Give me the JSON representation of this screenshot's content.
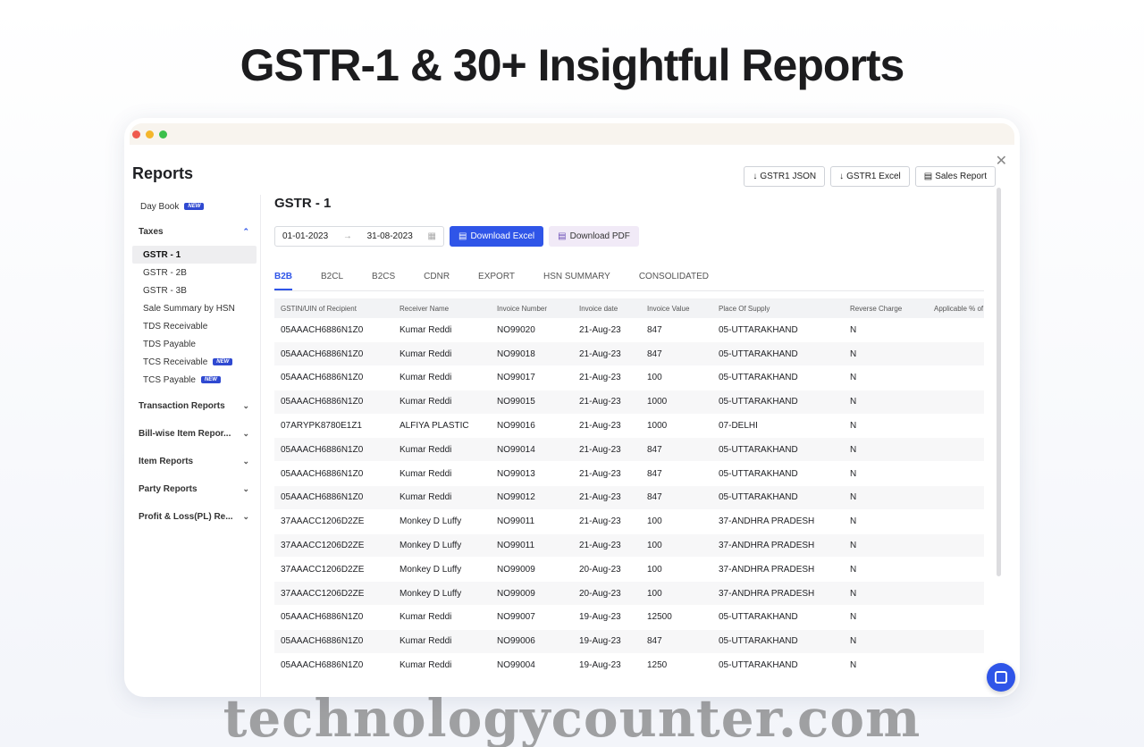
{
  "headline": "GSTR-1 & 30+ Insightful Reports",
  "page_title": "Reports",
  "top_actions": {
    "json": "GSTR1 JSON",
    "excel": "GSTR1 Excel",
    "sales": "Sales Report"
  },
  "sidebar": {
    "day_book": "Day Book",
    "new_badge": "NEW",
    "taxes": "Taxes",
    "tax_items": [
      "GSTR - 1",
      "GSTR - 2B",
      "GSTR - 3B",
      "Sale Summary by HSN",
      "TDS Receivable",
      "TDS Payable",
      "TCS Receivable",
      "TCS Payable"
    ],
    "groups": [
      "Transaction Reports",
      "Bill-wise Item Repor...",
      "Item Reports",
      "Party Reports",
      "Profit & Loss(PL) Re..."
    ]
  },
  "main": {
    "title": "GSTR - 1",
    "date_from": "01-01-2023",
    "date_to": "31-08-2023",
    "download_excel": "Download Excel",
    "download_pdf": "Download PDF",
    "tabs": [
      "B2B",
      "B2CL",
      "B2CS",
      "CDNR",
      "EXPORT",
      "HSN SUMMARY",
      "CONSOLIDATED"
    ]
  },
  "table": {
    "columns": [
      "GSTIN/UIN of Recipient",
      "Receiver Name",
      "Invoice Number",
      "Invoice date",
      "Invoice Value",
      "Place Of Supply",
      "Reverse Charge",
      "Applicable % of"
    ],
    "rows": [
      [
        "05AAACH6886N1Z0",
        "Kumar Reddi",
        "NO99020",
        "21-Aug-23",
        "847",
        "05-UTTARAKHAND",
        "N",
        ""
      ],
      [
        "05AAACH6886N1Z0",
        "Kumar Reddi",
        "NO99018",
        "21-Aug-23",
        "847",
        "05-UTTARAKHAND",
        "N",
        ""
      ],
      [
        "05AAACH6886N1Z0",
        "Kumar Reddi",
        "NO99017",
        "21-Aug-23",
        "100",
        "05-UTTARAKHAND",
        "N",
        ""
      ],
      [
        "05AAACH6886N1Z0",
        "Kumar Reddi",
        "NO99015",
        "21-Aug-23",
        "1000",
        "05-UTTARAKHAND",
        "N",
        ""
      ],
      [
        "07ARYPK8780E1Z1",
        "ALFIYA PLASTIC",
        "NO99016",
        "21-Aug-23",
        "1000",
        "07-DELHI",
        "N",
        ""
      ],
      [
        "05AAACH6886N1Z0",
        "Kumar Reddi",
        "NO99014",
        "21-Aug-23",
        "847",
        "05-UTTARAKHAND",
        "N",
        ""
      ],
      [
        "05AAACH6886N1Z0",
        "Kumar Reddi",
        "NO99013",
        "21-Aug-23",
        "847",
        "05-UTTARAKHAND",
        "N",
        ""
      ],
      [
        "05AAACH6886N1Z0",
        "Kumar Reddi",
        "NO99012",
        "21-Aug-23",
        "847",
        "05-UTTARAKHAND",
        "N",
        ""
      ],
      [
        "37AAACC1206D2ZE",
        "Monkey D Luffy",
        "NO99011",
        "21-Aug-23",
        "100",
        "37-ANDHRA PRADESH",
        "N",
        ""
      ],
      [
        "37AAACC1206D2ZE",
        "Monkey D Luffy",
        "NO99011",
        "21-Aug-23",
        "100",
        "37-ANDHRA PRADESH",
        "N",
        ""
      ],
      [
        "37AAACC1206D2ZE",
        "Monkey D Luffy",
        "NO99009",
        "20-Aug-23",
        "100",
        "37-ANDHRA PRADESH",
        "N",
        ""
      ],
      [
        "37AAACC1206D2ZE",
        "Monkey D Luffy",
        "NO99009",
        "20-Aug-23",
        "100",
        "37-ANDHRA PRADESH",
        "N",
        ""
      ],
      [
        "05AAACH6886N1Z0",
        "Kumar Reddi",
        "NO99007",
        "19-Aug-23",
        "12500",
        "05-UTTARAKHAND",
        "N",
        ""
      ],
      [
        "05AAACH6886N1Z0",
        "Kumar Reddi",
        "NO99006",
        "19-Aug-23",
        "847",
        "05-UTTARAKHAND",
        "N",
        ""
      ],
      [
        "05AAACH6886N1Z0",
        "Kumar Reddi",
        "NO99004",
        "19-Aug-23",
        "1250",
        "05-UTTARAKHAND",
        "N",
        ""
      ]
    ]
  },
  "watermark": "technologycounter.com",
  "colors": {
    "accent": "#2f55e8",
    "badge": "#2f49d1"
  }
}
